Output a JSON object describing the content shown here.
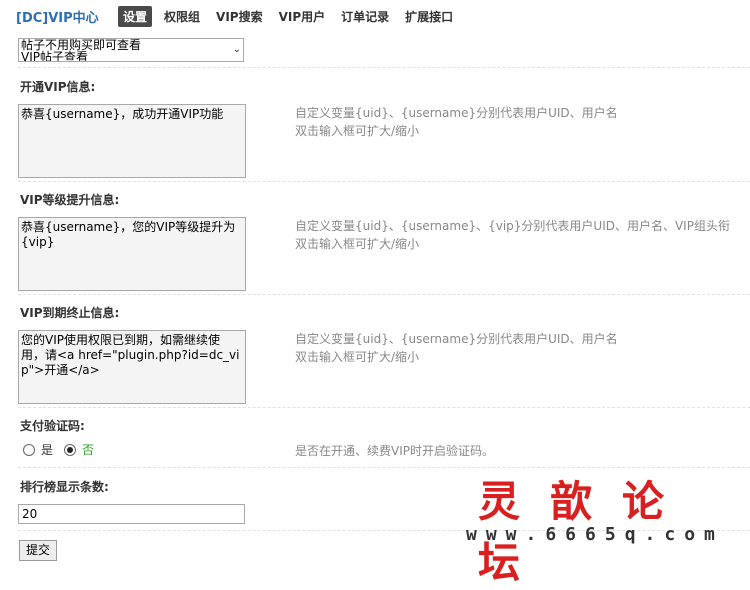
{
  "header": {
    "brand": "[DC]VIP中心",
    "tabs": [
      "设置",
      "权限组",
      "VIP搜索",
      "VIP用户",
      "订单记录",
      "扩展接口"
    ]
  },
  "select_partial": {
    "line1": "帖子不用购买即可查看",
    "line2": "VIP帖子查看"
  },
  "open_vip": {
    "label": "开通VIP信息:",
    "value": "恭喜{username}，成功开通VIP功能",
    "hint1": "自定义变量{uid}、{username}分别代表用户UID、用户名",
    "hint2": "双击输入框可扩大/缩小"
  },
  "level_up": {
    "label": "VIP等级提升信息:",
    "value": "恭喜{username}，您的VIP等级提升为{vip}",
    "hint1": "自定义变量{uid}、{username}、{vip}分别代表用户UID、用户名、VIP组头衔",
    "hint2": "双击输入框可扩大/缩小"
  },
  "expire": {
    "label": "VIP到期终止信息:",
    "value": "您的VIP使用权限已到期，如需继续使用，请<a href=\"plugin.php?id=dc_vip\">开通</a>",
    "hint1": "自定义变量{uid}、{username}分别代表用户UID、用户名",
    "hint2": "双击输入框可扩大/缩小"
  },
  "captcha": {
    "label": "支付验证码:",
    "yes": "是",
    "no": "否",
    "selected": "否",
    "hint": "是否在开通、续费VIP时开启验证码。"
  },
  "rank": {
    "label": "排行榜显示条数:",
    "value": "20"
  },
  "submit_label": "提交",
  "watermark": {
    "title": "灵歆论坛",
    "url": "www.6665q.com"
  },
  "colors": {
    "brand": "#2b6fb6",
    "active_tab_bg": "#4a4a4a",
    "selected_radio_text": "#2aa52a",
    "watermark": "#d92020"
  }
}
